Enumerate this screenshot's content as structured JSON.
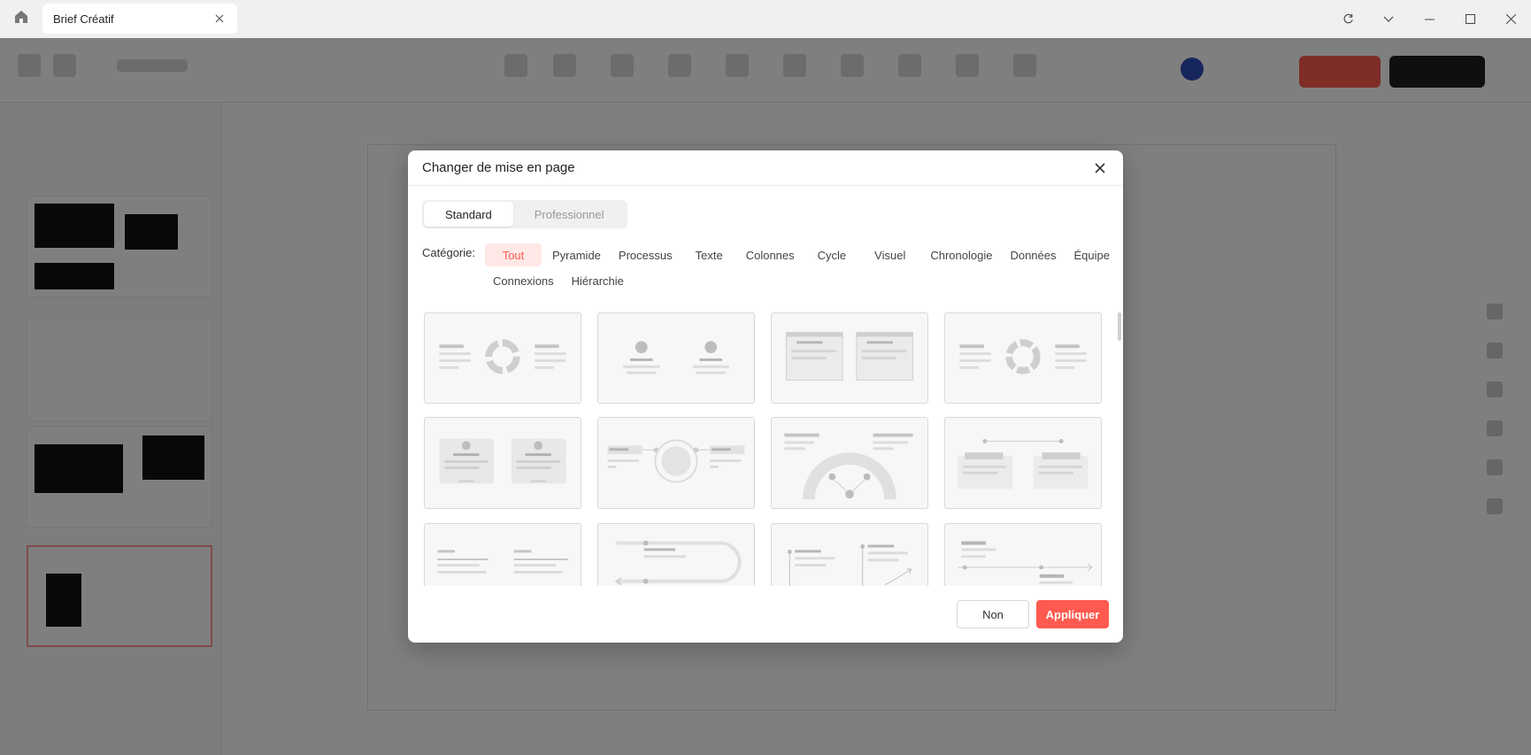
{
  "window": {
    "tab_title": "Brief Créatif"
  },
  "modal": {
    "title": "Changer de mise en page",
    "segments": [
      {
        "label": "Standard",
        "active": true
      },
      {
        "label": "Professionnel",
        "active": false
      }
    ],
    "category_label": "Catégorie:",
    "categories_row1": [
      "Tout",
      "Pyramide",
      "Processus",
      "Texte",
      "Colonnes",
      "Cycle",
      "Visuel",
      "Chronologie",
      "Données",
      "Équipe"
    ],
    "categories_row2": [
      "Connexions",
      "Hiérarchie"
    ],
    "active_category": "Tout",
    "layout_cards": [
      "donut-two-text",
      "two-avatars",
      "two-panels",
      "cycle-arrows",
      "two-profile-cards",
      "connected-circle",
      "semicircle-diagram",
      "two-boxes-connected",
      "two-text-columns",
      "u-curve-process",
      "vertical-lines-growth",
      "horizontal-timeline"
    ],
    "buttons": {
      "cancel": "Non",
      "apply": "Appliquer"
    }
  },
  "colors": {
    "accent": "#ff5a4f",
    "accent_light": "#ffe8e6"
  }
}
